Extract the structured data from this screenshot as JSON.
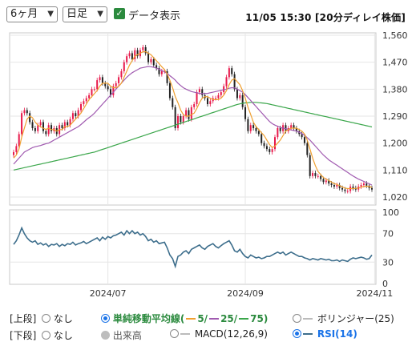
{
  "toolbar": {
    "period": "6ヶ月",
    "interval": "日足",
    "data_display_label": "データ表示",
    "timestamp": "11/05 15:30 [20分ディレイ株価]"
  },
  "controls": {
    "upper_label": "[上段]",
    "lower_label": "[下段]",
    "none": "なし",
    "sma_label": "単純移動平均線(",
    "sma_5": "5/",
    "sma_25": "25/",
    "sma_75": "75",
    "sma_close": ")",
    "bollinger": "ボリンジャー(25)",
    "volume": "出来高",
    "macd": "MACD(12,26,9)",
    "rsi": "RSI(14)"
  },
  "colors": {
    "up": "#e8194b",
    "down": "#222222",
    "ma5": "#f0a030",
    "ma25": "#a05ab0",
    "ma75": "#3aa64a",
    "rsi": "#3d6e8c",
    "active": "#1a73e8"
  },
  "chart_data": [
    {
      "type": "candlestick",
      "price_axis_ticks": [
        1020,
        1110,
        1200,
        1290,
        1380,
        1470,
        1560
      ],
      "ylim": [
        1020,
        1560
      ],
      "x_tick_labels": [
        "2024/07",
        "2024/09",
        "2024/11"
      ],
      "x_tick_index": [
        35,
        86,
        134
      ],
      "closes": [
        1170,
        1190,
        1230,
        1300,
        1310,
        1300,
        1270,
        1250,
        1240,
        1260,
        1270,
        1240,
        1230,
        1260,
        1240,
        1250,
        1230,
        1260,
        1250,
        1270,
        1260,
        1280,
        1300,
        1290,
        1310,
        1330,
        1340,
        1350,
        1360,
        1380,
        1380,
        1410,
        1420,
        1400,
        1390,
        1380,
        1360,
        1390,
        1400,
        1420,
        1440,
        1470,
        1490,
        1500,
        1480,
        1510,
        1490,
        1510,
        1520,
        1500,
        1470,
        1480,
        1460,
        1450,
        1430,
        1440,
        1440,
        1400,
        1350,
        1320,
        1250,
        1290,
        1270,
        1290,
        1310,
        1280,
        1320,
        1330,
        1370,
        1380,
        1360,
        1350,
        1330,
        1340,
        1350,
        1350,
        1360,
        1370,
        1390,
        1420,
        1450,
        1430,
        1380,
        1350,
        1360,
        1320,
        1280,
        1240,
        1260,
        1250,
        1240,
        1230,
        1200,
        1190,
        1180,
        1170,
        1180,
        1220,
        1250,
        1240,
        1260,
        1240,
        1250,
        1260,
        1250,
        1240,
        1230,
        1220,
        1200,
        1160,
        1090,
        1100,
        1090,
        1090,
        1080,
        1070,
        1075,
        1065,
        1060,
        1055,
        1060,
        1050,
        1045,
        1040,
        1040,
        1055,
        1050,
        1045,
        1055,
        1060,
        1065,
        1058,
        1050,
        1045
      ],
      "series": [
        {
          "name": "5",
          "values": [
            1150,
            1160,
            1180,
            1220,
            1250,
            1280,
            1290,
            1285,
            1270,
            1260,
            1255,
            1250,
            1245,
            1250,
            1245,
            1245,
            1240,
            1245,
            1245,
            1255,
            1255,
            1260,
            1270,
            1280,
            1290,
            1300,
            1315,
            1330,
            1345,
            1355,
            1365,
            1375,
            1390,
            1400,
            1400,
            1400,
            1390,
            1385,
            1385,
            1390,
            1400,
            1420,
            1440,
            1460,
            1475,
            1490,
            1495,
            1500,
            1505,
            1505,
            1500,
            1495,
            1485,
            1475,
            1465,
            1455,
            1445,
            1430,
            1410,
            1385,
            1355,
            1335,
            1310,
            1295,
            1290,
            1290,
            1295,
            1300,
            1315,
            1335,
            1350,
            1355,
            1355,
            1350,
            1345,
            1345,
            1345,
            1350,
            1360,
            1375,
            1395,
            1410,
            1415,
            1405,
            1395,
            1375,
            1350,
            1320,
            1295,
            1270,
            1255,
            1245,
            1235,
            1225,
            1210,
            1195,
            1185,
            1190,
            1200,
            1210,
            1225,
            1240,
            1245,
            1250,
            1250,
            1250,
            1245,
            1240,
            1230,
            1210,
            1180,
            1150,
            1125,
            1105,
            1095,
            1085,
            1080,
            1075,
            1070,
            1065,
            1062,
            1058,
            1054,
            1050,
            1048,
            1048,
            1048,
            1049,
            1050,
            1053,
            1055,
            1056,
            1055,
            1052
          ]
        },
        {
          "name": "25",
          "values": [
            1130,
            1140,
            1150,
            1160,
            1170,
            1175,
            1180,
            1185,
            1188,
            1190,
            1192,
            1195,
            1198,
            1200,
            1205,
            1210,
            1215,
            1220,
            1225,
            1230,
            1235,
            1240,
            1245,
            1250,
            1255,
            1262,
            1270,
            1278,
            1285,
            1292,
            1300,
            1310,
            1320,
            1330,
            1340,
            1350,
            1360,
            1370,
            1380,
            1390,
            1400,
            1410,
            1420,
            1428,
            1435,
            1440,
            1445,
            1450,
            1452,
            1454,
            1456,
            1455,
            1453,
            1450,
            1446,
            1442,
            1438,
            1432,
            1425,
            1418,
            1410,
            1400,
            1392,
            1385,
            1380,
            1376,
            1372,
            1370,
            1368,
            1366,
            1365,
            1365,
            1366,
            1368,
            1370,
            1372,
            1374,
            1376,
            1378,
            1380,
            1383,
            1385,
            1384,
            1380,
            1375,
            1370,
            1362,
            1352,
            1342,
            1332,
            1322,
            1312,
            1302,
            1292,
            1282,
            1272,
            1265,
            1260,
            1256,
            1252,
            1250,
            1248,
            1246,
            1244,
            1242,
            1240,
            1236,
            1232,
            1226,
            1218,
            1210,
            1200,
            1190,
            1180,
            1170,
            1160,
            1152,
            1144,
            1138,
            1132,
            1126,
            1120,
            1114,
            1108,
            1102,
            1096,
            1090,
            1085,
            1080,
            1076,
            1072,
            1068,
            1064,
            1060
          ]
        },
        {
          "name": "75",
          "values": [
            1110,
            1112,
            1114,
            1116,
            1118,
            1120,
            1122,
            1124,
            1126,
            1128,
            1130,
            1132,
            1134,
            1136,
            1138,
            1140,
            1142,
            1144,
            1146,
            1148,
            1150,
            1152,
            1154,
            1156,
            1158,
            1160,
            1162,
            1164,
            1166,
            1168,
            1170,
            1173,
            1176,
            1179,
            1182,
            1185,
            1188,
            1191,
            1194,
            1197,
            1200,
            1203,
            1206,
            1209,
            1212,
            1215,
            1218,
            1221,
            1224,
            1227,
            1230,
            1233,
            1236,
            1239,
            1242,
            1245,
            1248,
            1251,
            1254,
            1257,
            1260,
            1263,
            1266,
            1269,
            1272,
            1275,
            1278,
            1281,
            1284,
            1287,
            1290,
            1293,
            1296,
            1299,
            1302,
            1305,
            1308,
            1311,
            1314,
            1317,
            1320,
            1323,
            1326,
            1329,
            1331,
            1333,
            1334,
            1335,
            1336,
            1336,
            1336,
            1335,
            1334,
            1333,
            1332,
            1330,
            1328,
            1326,
            1324,
            1322,
            1320,
            1318,
            1316,
            1314,
            1312,
            1310,
            1308,
            1306,
            1304,
            1302,
            1300,
            1298,
            1296,
            1294,
            1292,
            1290,
            1288,
            1286,
            1284,
            1282,
            1280,
            1278,
            1276,
            1274,
            1272,
            1270,
            1268,
            1266,
            1264,
            1262,
            1260,
            1258,
            1256,
            1254
          ]
        }
      ]
    },
    {
      "type": "line",
      "name": "RSI(14)",
      "ylim": [
        0,
        100
      ],
      "axis_ticks": [
        0,
        30,
        70,
        100
      ],
      "values": [
        55,
        60,
        68,
        78,
        70,
        64,
        60,
        58,
        60,
        55,
        57,
        54,
        56,
        52,
        55,
        54,
        56,
        52,
        55,
        53,
        56,
        55,
        58,
        54,
        56,
        57,
        59,
        56,
        58,
        60,
        62,
        64,
        60,
        65,
        62,
        66,
        64,
        67,
        68,
        70,
        72,
        68,
        74,
        70,
        74,
        70,
        72,
        68,
        70,
        66,
        60,
        62,
        58,
        60,
        56,
        57,
        58,
        50,
        40,
        35,
        24,
        38,
        40,
        44,
        46,
        42,
        48,
        50,
        52,
        54,
        50,
        48,
        52,
        54,
        56,
        52,
        50,
        53,
        56,
        58,
        60,
        54,
        46,
        44,
        48,
        42,
        38,
        36,
        40,
        38,
        36,
        37,
        35,
        36,
        38,
        38,
        40,
        42,
        44,
        42,
        44,
        40,
        42,
        44,
        42,
        40,
        38,
        38,
        36,
        35,
        33,
        35,
        34,
        33,
        35,
        34,
        33,
        34,
        32,
        32,
        33,
        31,
        33,
        32,
        31,
        34,
        36,
        35,
        36,
        37,
        36,
        34,
        35,
        40
      ]
    }
  ]
}
